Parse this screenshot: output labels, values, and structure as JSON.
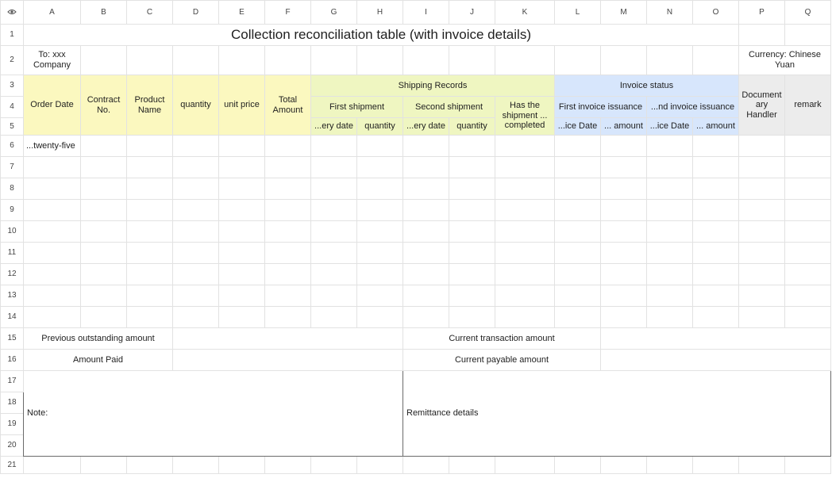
{
  "col_headers": [
    "A",
    "B",
    "C",
    "D",
    "E",
    "F",
    "G",
    "H",
    "I",
    "J",
    "K",
    "L",
    "M",
    "N",
    "O",
    "P",
    "Q"
  ],
  "row_numbers": [
    "1",
    "2",
    "3",
    "4",
    "5",
    "6",
    "7",
    "8",
    "9",
    "10",
    "11",
    "12",
    "13",
    "14",
    "15",
    "16",
    "17",
    "18",
    "19",
    "20",
    "21"
  ],
  "title": "Collection reconciliation table (with invoice details)",
  "to_company": "To: xxx Company",
  "currency": "Currency: Chinese Yuan",
  "headers": {
    "order_date": "Order Date",
    "contract_no": "Contract No.",
    "product_name": "Product Name",
    "quantity": "quantity",
    "unit_price": "unit price",
    "total_amount": "Total Amount",
    "shipping_records": "Shipping Records",
    "first_shipment": "First shipment",
    "second_shipment": "Second shipment",
    "has_shipment_completed": "Has the shipment ... completed",
    "delivery_date_1": "...ery date",
    "quantity_1": "quantity",
    "delivery_date_2": "...ery date",
    "quantity_2": "quantity",
    "invoice_status": "Invoice status",
    "first_invoice": "First invoice issuance",
    "second_invoice": "...nd invoice issuance",
    "invoice_date_1": "...ice Date",
    "invoice_amount_1": "... amount",
    "invoice_date_2": "...ice Date",
    "invoice_amount_2": "... amount",
    "documentary_handler": "Document ary Handler",
    "remark": "remark"
  },
  "a6_value": "...twenty-five",
  "footer": {
    "previous_outstanding": "Previous outstanding amount",
    "current_transaction": "Current transaction amount",
    "amount_paid": "Amount Paid",
    "current_payable": "Current payable amount",
    "note": "Note:",
    "remittance_details": "Remittance details"
  },
  "colors": {
    "yellow_header": "#fbf8bf",
    "green_header": "#eff6c1",
    "blue_header": "#d7e6fc",
    "gray_header": "#ececec",
    "grid_line": "#e2e2e2"
  },
  "icons": {
    "corner": "eye-icon"
  }
}
